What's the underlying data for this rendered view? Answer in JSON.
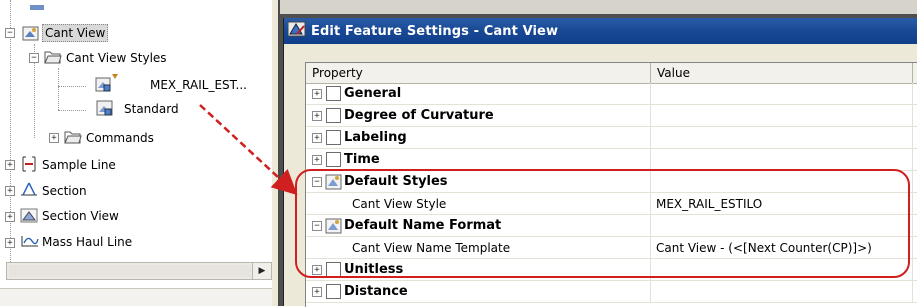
{
  "tree": {
    "items": [
      {
        "label": "Cant View"
      },
      {
        "label": "Cant View Styles"
      },
      {
        "label": "MEX_RAIL_EST..."
      },
      {
        "label": "Standard"
      },
      {
        "label": "Commands"
      },
      {
        "label": "Sample Line"
      },
      {
        "label": "Section"
      },
      {
        "label": "Section View"
      },
      {
        "label": "Mass Haul Line"
      }
    ]
  },
  "dialog": {
    "title": "Edit Feature Settings - Cant View",
    "columns": {
      "property": "Property",
      "value": "Value"
    },
    "rows": [
      {
        "property": "General",
        "value": ""
      },
      {
        "property": "Degree of Curvature",
        "value": ""
      },
      {
        "property": "Labeling",
        "value": ""
      },
      {
        "property": "Time",
        "value": ""
      },
      {
        "property": "Default Styles",
        "value": ""
      },
      {
        "property": "Cant View Style",
        "value": "MEX_RAIL_ESTILO"
      },
      {
        "property": "Default Name Format",
        "value": ""
      },
      {
        "property": "Cant View Name Template",
        "value": "Cant View - (<[Next Counter(CP)]>)"
      },
      {
        "property": "Unitless",
        "value": ""
      },
      {
        "property": "Distance",
        "value": ""
      }
    ]
  },
  "colors": {
    "highlight": "#d01f1f",
    "titlebar": "#1a4a95",
    "dialog_bg": "#ece9d8"
  },
  "icons": [
    "cant-view-icon",
    "folder-icon",
    "style-icon",
    "sample-line-icon",
    "section-icon",
    "section-view-icon",
    "mass-haul-icon",
    "document-icon",
    "style-sheet-icon"
  ]
}
